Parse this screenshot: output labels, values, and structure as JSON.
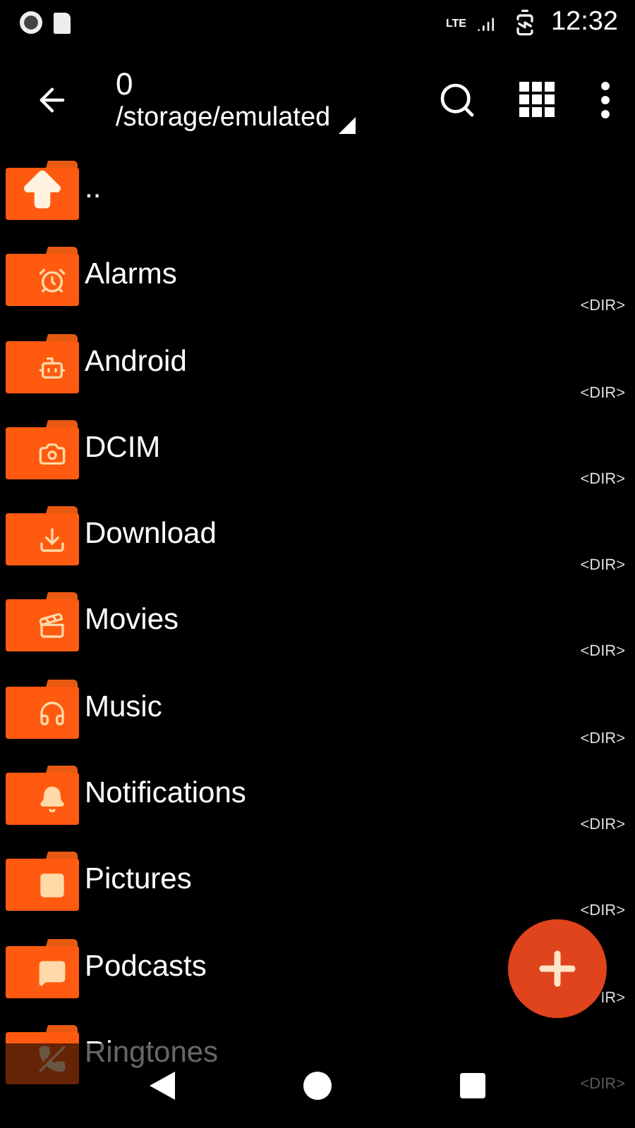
{
  "status_bar": {
    "network": "LTE",
    "time": "12:32"
  },
  "toolbar": {
    "title": "0",
    "path": "/storage/emulated"
  },
  "entries": [
    {
      "kind": "parent",
      "name": ".."
    },
    {
      "kind": "folder",
      "name": "Alarms",
      "type": "<DIR>"
    },
    {
      "kind": "folder",
      "name": "Android",
      "type": "<DIR>"
    },
    {
      "kind": "folder",
      "name": "DCIM",
      "type": "<DIR>"
    },
    {
      "kind": "folder",
      "name": "Download",
      "type": "<DIR>"
    },
    {
      "kind": "folder",
      "name": "Movies",
      "type": "<DIR>"
    },
    {
      "kind": "folder",
      "name": "Music",
      "type": "<DIR>"
    },
    {
      "kind": "folder",
      "name": "Notifications",
      "type": "<DIR>"
    },
    {
      "kind": "folder",
      "name": "Pictures",
      "type": "<DIR>"
    },
    {
      "kind": "folder",
      "name": "Podcasts",
      "type": "IR>"
    },
    {
      "kind": "folder",
      "name": "Ringtones",
      "type": "<DIR>"
    }
  ]
}
